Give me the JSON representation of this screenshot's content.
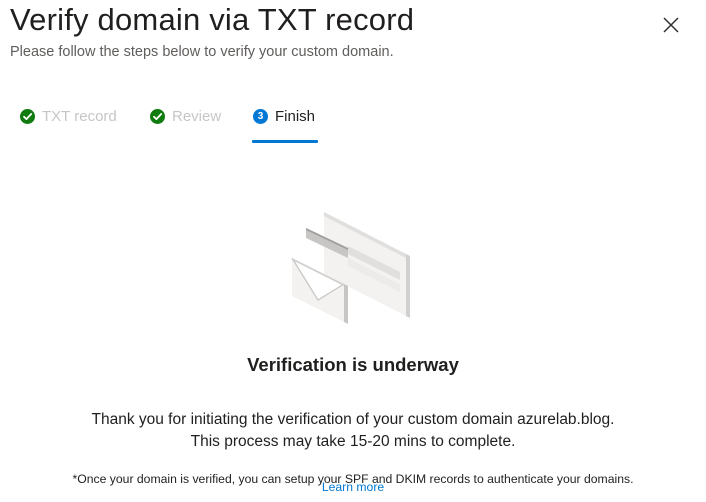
{
  "header": {
    "title": "Verify domain via TXT record",
    "subtitle": "Please follow the steps below to verify your custom domain.",
    "close_icon": "close-icon"
  },
  "steps": [
    {
      "label": "TXT record",
      "state": "completed",
      "icon": "check-icon"
    },
    {
      "label": "Review",
      "state": "completed",
      "icon": "check-icon"
    },
    {
      "label": "Finish",
      "state": "current",
      "number": "3"
    }
  ],
  "main": {
    "illustration_icon": "email-envelope-illustration",
    "headline": "Verification is underway",
    "body_line1": "Thank you for initiating the verification of your custom domain azurelab.blog.",
    "body_line2": "This process may take 15-20 mins to complete.",
    "footnote": "*Once your domain is verified, you can setup your SPF and DKIM records to authenticate your domains.",
    "learn_more": "Learn more"
  },
  "colors": {
    "accent": "#0078d4",
    "success": "#107c10",
    "disabled_text": "#c8c6c4",
    "text": "#201f1e"
  }
}
